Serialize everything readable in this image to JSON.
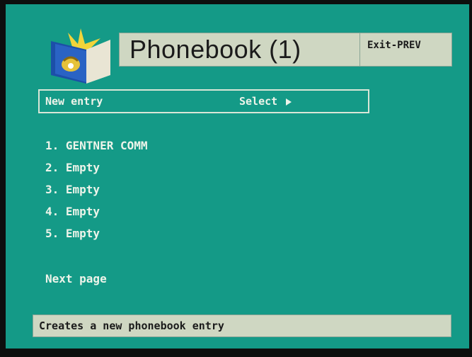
{
  "header": {
    "title": "Phonebook (1)",
    "exit_label": "Exit-PREV"
  },
  "new_entry": {
    "label": "New entry",
    "action_label": "Select"
  },
  "entries": [
    {
      "label": "1. GENTNER COMM"
    },
    {
      "label": "2. Empty"
    },
    {
      "label": "3. Empty"
    },
    {
      "label": "4. Empty"
    },
    {
      "label": "5. Empty"
    }
  ],
  "next_page_label": "Next page",
  "status": {
    "text": "Creates a new phonebook entry"
  },
  "colors": {
    "background": "#149a87",
    "panel": "#cfd7c2",
    "text_light": "#eef4ea",
    "text_dark": "#1b1b1b"
  },
  "icons": {
    "logo": "phonebook-icon",
    "select_arrow": "triangle-right-icon"
  }
}
